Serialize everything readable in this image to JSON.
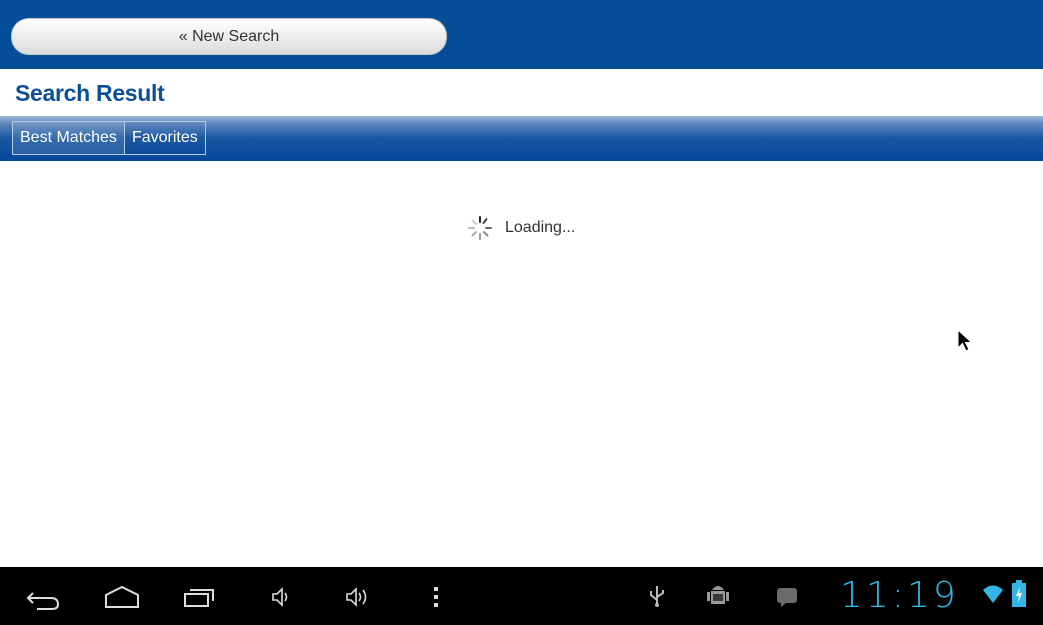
{
  "toolbar": {
    "new_search_label": "« New Search"
  },
  "page": {
    "heading": "Search Result"
  },
  "tabs": [
    {
      "label": "Best Matches",
      "active": true
    },
    {
      "label": "Favorites",
      "active": false
    }
  ],
  "loading": {
    "text": "Loading..."
  },
  "system_bar": {
    "clock": "11:19",
    "nav_buttons": [
      "back-icon",
      "home-icon",
      "recent-apps-icon",
      "volume-down-icon",
      "volume-up-icon",
      "menu-icon"
    ],
    "notification_icons": [
      "usb-icon",
      "android-debug-icon",
      "blog-notification-icon"
    ],
    "status_icons": [
      "wifi-icon",
      "battery-charging-icon"
    ],
    "accent_color": "#33b5e5"
  },
  "colors": {
    "brand_blue": "#044e97",
    "heading_blue": "#0c4f96"
  }
}
